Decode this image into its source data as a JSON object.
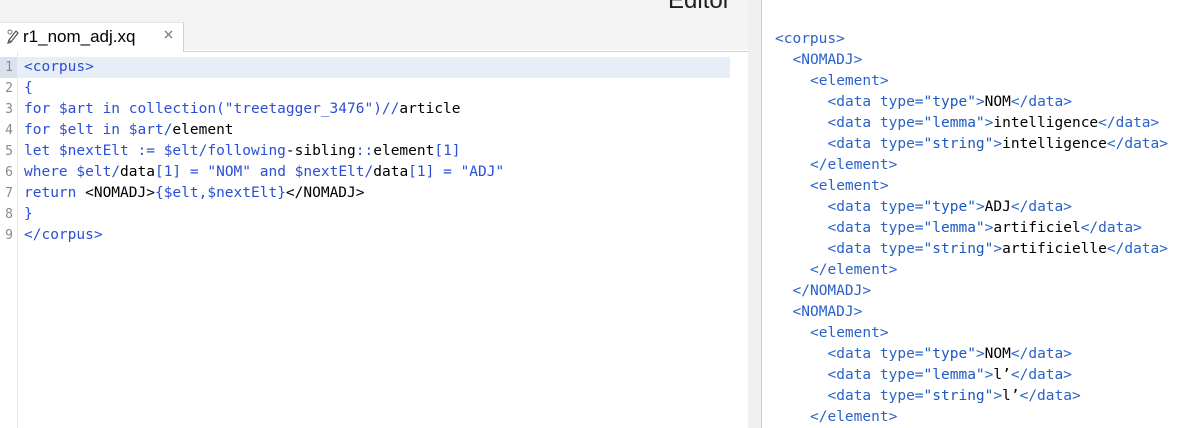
{
  "header": {
    "panel_title": "Editor"
  },
  "tab": {
    "label": "r1_nom_adj.xq",
    "icon": "pencil-icon",
    "close_icon": "close-icon"
  },
  "editor": {
    "current_line": 1,
    "lines": [
      {
        "num": "1",
        "parts": [
          {
            "c": "tag",
            "t": "<corpus>"
          }
        ]
      },
      {
        "num": "2",
        "parts": [
          {
            "c": "kw",
            "t": "{"
          }
        ]
      },
      {
        "num": "3",
        "parts": [
          {
            "c": "kw",
            "t": "for "
          },
          {
            "c": "var",
            "t": "$art"
          },
          {
            "c": "kw",
            "t": " in "
          },
          {
            "c": "kw",
            "t": "collection("
          },
          {
            "c": "str",
            "t": "\"treetagger_3476\""
          },
          {
            "c": "kw",
            "t": ")//"
          },
          {
            "c": "txt",
            "t": "article"
          }
        ]
      },
      {
        "num": "4",
        "parts": [
          {
            "c": "kw",
            "t": "for "
          },
          {
            "c": "var",
            "t": "$elt"
          },
          {
            "c": "kw",
            "t": " in "
          },
          {
            "c": "var",
            "t": "$art"
          },
          {
            "c": "kw",
            "t": "/"
          },
          {
            "c": "txt",
            "t": "element"
          }
        ]
      },
      {
        "num": "5",
        "parts": [
          {
            "c": "kw",
            "t": "let "
          },
          {
            "c": "var",
            "t": "$nextElt"
          },
          {
            "c": "kw",
            "t": " := "
          },
          {
            "c": "var",
            "t": "$elt"
          },
          {
            "c": "kw",
            "t": "/following"
          },
          {
            "c": "txt",
            "t": "-sibling"
          },
          {
            "c": "kw",
            "t": "::"
          },
          {
            "c": "txt",
            "t": "element"
          },
          {
            "c": "kw",
            "t": "[1]"
          }
        ]
      },
      {
        "num": "6",
        "parts": [
          {
            "c": "kw",
            "t": "where "
          },
          {
            "c": "var",
            "t": "$elt"
          },
          {
            "c": "kw",
            "t": "/"
          },
          {
            "c": "txt",
            "t": "data"
          },
          {
            "c": "kw",
            "t": "[1] = "
          },
          {
            "c": "str",
            "t": "\"NOM\""
          },
          {
            "c": "kw",
            "t": " and "
          },
          {
            "c": "var",
            "t": "$nextElt"
          },
          {
            "c": "kw",
            "t": "/"
          },
          {
            "c": "txt",
            "t": "data"
          },
          {
            "c": "kw",
            "t": "[1] = "
          },
          {
            "c": "str",
            "t": "\"ADJ\""
          }
        ]
      },
      {
        "num": "7",
        "parts": [
          {
            "c": "kw",
            "t": "return "
          },
          {
            "c": "txt",
            "t": "<NOMADJ>"
          },
          {
            "c": "kw",
            "t": "{"
          },
          {
            "c": "var",
            "t": "$elt"
          },
          {
            "c": "kw",
            "t": ","
          },
          {
            "c": "var",
            "t": "$nextElt"
          },
          {
            "c": "kw",
            "t": "}"
          },
          {
            "c": "txt",
            "t": "</NOMADJ>"
          }
        ]
      },
      {
        "num": "8",
        "parts": [
          {
            "c": "kw",
            "t": "}"
          }
        ]
      },
      {
        "num": "9",
        "parts": [
          {
            "c": "tag",
            "t": "</corpus>"
          }
        ]
      }
    ]
  },
  "result": {
    "lines": [
      {
        "indent": 0,
        "parts": [
          {
            "c": "r-tag",
            "t": "<corpus>"
          }
        ]
      },
      {
        "indent": 1,
        "parts": [
          {
            "c": "r-tag",
            "t": "<NOMADJ>"
          }
        ]
      },
      {
        "indent": 2,
        "parts": [
          {
            "c": "r-tag",
            "t": "<element>"
          }
        ]
      },
      {
        "indent": 3,
        "parts": [
          {
            "c": "r-tag",
            "t": "<data "
          },
          {
            "c": "r-attr",
            "t": "type="
          },
          {
            "c": "r-val",
            "t": "\"type\""
          },
          {
            "c": "r-tag",
            "t": ">"
          },
          {
            "c": "r-text",
            "t": "NOM"
          },
          {
            "c": "r-tag",
            "t": "</data>"
          }
        ]
      },
      {
        "indent": 3,
        "parts": [
          {
            "c": "r-tag",
            "t": "<data "
          },
          {
            "c": "r-attr",
            "t": "type="
          },
          {
            "c": "r-val",
            "t": "\"lemma\""
          },
          {
            "c": "r-tag",
            "t": ">"
          },
          {
            "c": "r-text",
            "t": "intelligence"
          },
          {
            "c": "r-tag",
            "t": "</data>"
          }
        ]
      },
      {
        "indent": 3,
        "parts": [
          {
            "c": "r-tag",
            "t": "<data "
          },
          {
            "c": "r-attr",
            "t": "type="
          },
          {
            "c": "r-val",
            "t": "\"string\""
          },
          {
            "c": "r-tag",
            "t": ">"
          },
          {
            "c": "r-text",
            "t": "intelligence"
          },
          {
            "c": "r-tag",
            "t": "</data>"
          }
        ]
      },
      {
        "indent": 2,
        "parts": [
          {
            "c": "r-tag",
            "t": "</element>"
          }
        ]
      },
      {
        "indent": 2,
        "parts": [
          {
            "c": "r-tag",
            "t": "<element>"
          }
        ]
      },
      {
        "indent": 3,
        "parts": [
          {
            "c": "r-tag",
            "t": "<data "
          },
          {
            "c": "r-attr",
            "t": "type="
          },
          {
            "c": "r-val",
            "t": "\"type\""
          },
          {
            "c": "r-tag",
            "t": ">"
          },
          {
            "c": "r-text",
            "t": "ADJ"
          },
          {
            "c": "r-tag",
            "t": "</data>"
          }
        ]
      },
      {
        "indent": 3,
        "parts": [
          {
            "c": "r-tag",
            "t": "<data "
          },
          {
            "c": "r-attr",
            "t": "type="
          },
          {
            "c": "r-val",
            "t": "\"lemma\""
          },
          {
            "c": "r-tag",
            "t": ">"
          },
          {
            "c": "r-text",
            "t": "artificiel"
          },
          {
            "c": "r-tag",
            "t": "</data>"
          }
        ]
      },
      {
        "indent": 3,
        "parts": [
          {
            "c": "r-tag",
            "t": "<data "
          },
          {
            "c": "r-attr",
            "t": "type="
          },
          {
            "c": "r-val",
            "t": "\"string\""
          },
          {
            "c": "r-tag",
            "t": ">"
          },
          {
            "c": "r-text",
            "t": "artificielle"
          },
          {
            "c": "r-tag",
            "t": "</data>"
          }
        ]
      },
      {
        "indent": 2,
        "parts": [
          {
            "c": "r-tag",
            "t": "</element>"
          }
        ]
      },
      {
        "indent": 1,
        "parts": [
          {
            "c": "r-tag",
            "t": "</NOMADJ>"
          }
        ]
      },
      {
        "indent": 1,
        "parts": [
          {
            "c": "r-tag",
            "t": "<NOMADJ>"
          }
        ]
      },
      {
        "indent": 2,
        "parts": [
          {
            "c": "r-tag",
            "t": "<element>"
          }
        ]
      },
      {
        "indent": 3,
        "parts": [
          {
            "c": "r-tag",
            "t": "<data "
          },
          {
            "c": "r-attr",
            "t": "type="
          },
          {
            "c": "r-val",
            "t": "\"type\""
          },
          {
            "c": "r-tag",
            "t": ">"
          },
          {
            "c": "r-text",
            "t": "NOM"
          },
          {
            "c": "r-tag",
            "t": "</data>"
          }
        ]
      },
      {
        "indent": 3,
        "parts": [
          {
            "c": "r-tag",
            "t": "<data "
          },
          {
            "c": "r-attr",
            "t": "type="
          },
          {
            "c": "r-val",
            "t": "\"lemma\""
          },
          {
            "c": "r-tag",
            "t": ">"
          },
          {
            "c": "r-text",
            "t": "l’"
          },
          {
            "c": "r-tag",
            "t": "</data>"
          }
        ]
      },
      {
        "indent": 3,
        "parts": [
          {
            "c": "r-tag",
            "t": "<data "
          },
          {
            "c": "r-attr",
            "t": "type="
          },
          {
            "c": "r-val",
            "t": "\"string\""
          },
          {
            "c": "r-tag",
            "t": ">"
          },
          {
            "c": "r-text",
            "t": "l’"
          },
          {
            "c": "r-tag",
            "t": "</data>"
          }
        ]
      },
      {
        "indent": 2,
        "parts": [
          {
            "c": "r-tag",
            "t": "</element>"
          }
        ]
      }
    ]
  },
  "colors": {
    "keyword": "#2a4fd6",
    "current_line_bg": "#e8eef7",
    "result_markup": "#2a62c8"
  }
}
